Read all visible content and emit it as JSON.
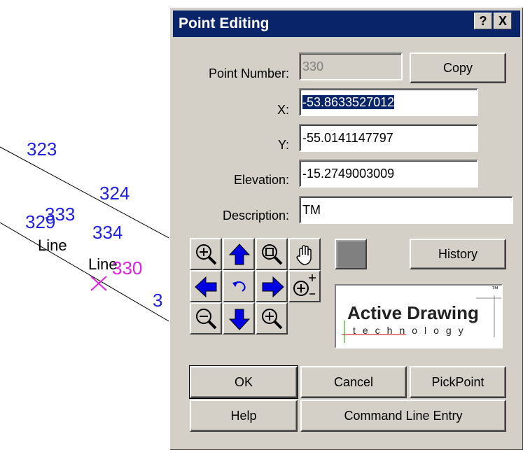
{
  "drawing": {
    "points": [
      "323",
      "324",
      "333",
      "329",
      "334",
      "330",
      "3"
    ],
    "line_labels": [
      "Line",
      "Line"
    ],
    "point_color": "#2020e0",
    "selected_color": "#e020e0"
  },
  "dialog": {
    "title": "Point Editing",
    "help_button": "?",
    "close_button": "X",
    "labels": {
      "point_number": "Point Number:",
      "x": "X:",
      "y": "Y:",
      "elevation": "Elevation:",
      "description": "Description:"
    },
    "values": {
      "point_number": "330",
      "x": "-53.8633527012",
      "y": "-55.0141147797",
      "elevation": "-15.2749003009",
      "description": "TM"
    },
    "buttons": {
      "copy": "Copy",
      "history": "History",
      "ok": "OK",
      "cancel": "Cancel",
      "pickpoint": "PickPoint",
      "help": "Help",
      "command_line": "Command Line Entry"
    },
    "logo": {
      "title": "Active Drawing",
      "subtitle": "technology",
      "tm": "™"
    },
    "nav_icons": [
      "zoom-extents-icon",
      "pan-up-icon",
      "zoom-window-icon",
      "pan-hand-icon",
      "pan-left-icon",
      "undo-view-icon",
      "pan-right-icon",
      "zoom-realtime-icon",
      "zoom-out-icon",
      "pan-down-icon",
      "zoom-in-icon"
    ],
    "colors": {
      "titlebar": "#0a246a",
      "face": "#d4d0c8",
      "swatch": "#808080"
    }
  }
}
